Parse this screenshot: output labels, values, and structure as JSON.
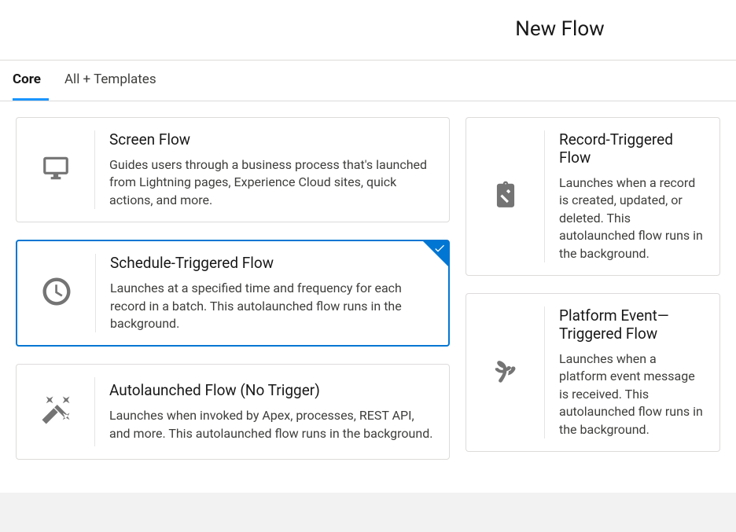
{
  "header": {
    "title": "New Flow"
  },
  "tabs": [
    {
      "label": "Core",
      "active": true
    },
    {
      "label": "All + Templates",
      "active": false
    }
  ],
  "cards_left": [
    {
      "title": "Screen Flow",
      "description": "Guides users through a business process that's launched from Lightning pages, Experience Cloud sites, quick actions, and more.",
      "selected": false,
      "icon": "monitor"
    },
    {
      "title": "Schedule-Triggered Flow",
      "description": "Launches at a specified time and frequency for each record in a batch. This autolaunched flow runs in the background.",
      "selected": true,
      "icon": "clock"
    },
    {
      "title": "Autolaunched Flow (No Trigger)",
      "description": "Launches when invoked by Apex, processes, REST API, and more. This autolaunched flow runs in the background.",
      "selected": false,
      "icon": "wand"
    }
  ],
  "cards_right": [
    {
      "title": "Record-Triggered Flow",
      "description": "Launches when a record is created, updated, or deleted. This autolaunched flow runs in the background.",
      "selected": false,
      "icon": "clipboard"
    },
    {
      "title": "Platform Event—Triggered Flow",
      "description": "Launches when a platform event message is received. This autolaunched flow runs in the background.",
      "selected": false,
      "icon": "broadcast"
    }
  ]
}
